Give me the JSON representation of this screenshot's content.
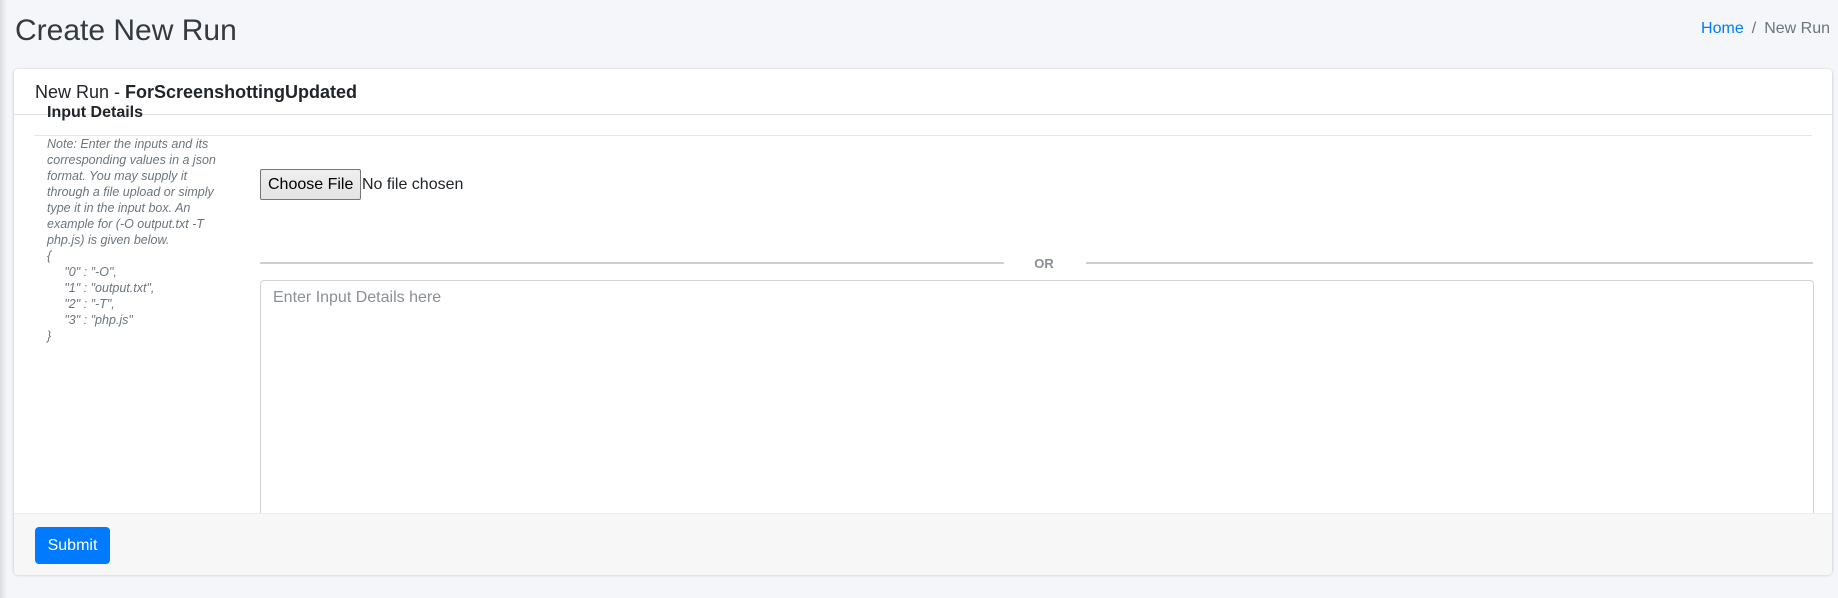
{
  "page": {
    "title": "Create New Run"
  },
  "breadcrumb": {
    "home": "Home",
    "separator": "/",
    "current": "New Run"
  },
  "card": {
    "header_prefix": "New Run - ",
    "header_name": "ForScreenshottingUpdated"
  },
  "input_details": {
    "label": "Input Details",
    "note": "Note: Enter the inputs and its corresponding values in a json format. You may supply it through a file upload or simply type it in the input box. An example for (-O output.txt -T php.js) is given below.\n{\n     \"0\" : \"-O\",\n     \"1\" : \"output.txt\",\n     \"2\" : \"-T\",\n     \"3\" : \"php.js\"\n}",
    "file_button_label": "Choose File",
    "file_status": "No file chosen",
    "divider_text": "OR",
    "textarea_placeholder": "Enter Input Details here",
    "textarea_value": ""
  },
  "footer": {
    "submit_label": "Submit"
  },
  "colors": {
    "background": "#f4f6f9",
    "primary": "#007bff",
    "card": "#ffffff",
    "footer": "#f7f7f7"
  }
}
